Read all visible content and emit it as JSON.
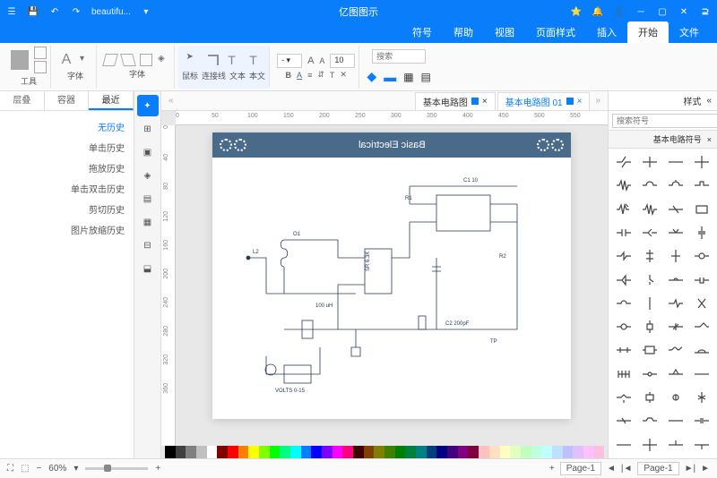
{
  "titlebar": {
    "app_title": "亿图图示",
    "file_name": "beautifu..."
  },
  "menubar": {
    "tabs": [
      "文件",
      "开始",
      "插入",
      "页面样式",
      "视图",
      "帮助",
      "符号"
    ],
    "active_index": 1
  },
  "ribbon": {
    "tools_label": "工具",
    "font_label": "字体",
    "cursor_label": "鼠标",
    "connector_label": "连接线",
    "text_label": "文本",
    "insert_label": "本文",
    "font_size": "10",
    "search_placeholder": "搜索"
  },
  "leftpanel": {
    "tabs": [
      "层叠",
      "容器",
      "最近"
    ],
    "active_index": 2,
    "items": [
      "无历史",
      "单击历史",
      "拖放历史",
      "单击双击历史",
      "剪切历史",
      "图片放缩历史"
    ]
  },
  "doc_tabs": {
    "tabs": [
      {
        "label": "基本电路图 01",
        "active": true
      },
      {
        "label": "基本电路图"
      }
    ]
  },
  "ruler_h": [
    "0",
    "50",
    "100",
    "150",
    "200",
    "250",
    "300",
    "350",
    "400",
    "450",
    "500",
    "550"
  ],
  "ruler_v": [
    "0",
    "40",
    "80",
    "120",
    "160",
    "200",
    "240",
    "280",
    "320",
    "360"
  ],
  "page": {
    "header_title": "Basic Electrical"
  },
  "rightpanel": {
    "header_label": "样式",
    "search_placeholder": "搜索符号",
    "section_label": "基本电路符号"
  },
  "statusbar": {
    "page_label": "Page-1",
    "zoom": "60%",
    "plus": "+",
    "minus": "−"
  },
  "colors": [
    "#000000",
    "#404040",
    "#808080",
    "#c0c0c0",
    "#ffffff",
    "#800000",
    "#ff0000",
    "#ff8000",
    "#ffff00",
    "#80ff00",
    "#00ff00",
    "#00ff80",
    "#00ffff",
    "#0080ff",
    "#0000ff",
    "#8000ff",
    "#ff00ff",
    "#ff0080",
    "#400000",
    "#804000",
    "#808000",
    "#408000",
    "#008000",
    "#008040",
    "#008080",
    "#004080",
    "#000080",
    "#400080",
    "#800080",
    "#800040",
    "#ffc0c0",
    "#ffe0c0",
    "#ffffc0",
    "#e0ffc0",
    "#c0ffc0",
    "#c0ffe0",
    "#c0ffff",
    "#c0e0ff",
    "#c0c0ff",
    "#e0c0ff",
    "#ffc0ff",
    "#ffc0e0"
  ]
}
